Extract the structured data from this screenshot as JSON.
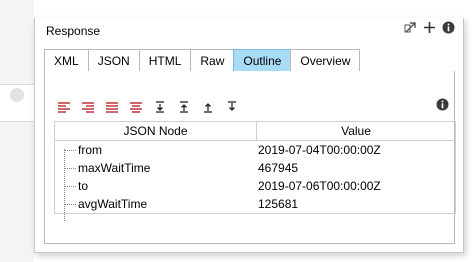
{
  "panel": {
    "title": "Response"
  },
  "top_icons": [
    "pin-icon",
    "add-icon",
    "info-icon"
  ],
  "tabs": [
    {
      "label": "XML",
      "active": false
    },
    {
      "label": "JSON",
      "active": false
    },
    {
      "label": "HTML",
      "active": false
    },
    {
      "label": "Raw",
      "active": false
    },
    {
      "label": "Outline",
      "active": true
    },
    {
      "label": "Overview",
      "active": false
    }
  ],
  "toolbar": [
    "align-icon-1",
    "align-icon-2",
    "align-icon-3",
    "align-icon-4",
    "collapse-icon",
    "expand-icon",
    "expand-all-icon",
    "collapse-all-icon"
  ],
  "grid": {
    "headers": {
      "node": "JSON Node",
      "value": "Value"
    },
    "rows": [
      {
        "node": "from",
        "value": "2019-07-04T00:00:00Z"
      },
      {
        "node": "maxWaitTime",
        "value": "467945"
      },
      {
        "node": "to",
        "value": "2019-07-06T00:00:00Z"
      },
      {
        "node": "avgWaitTime",
        "value": "125681"
      }
    ]
  },
  "colors": {
    "active_tab": "#a8dbf5",
    "toolbar_red": "#c0262d"
  }
}
